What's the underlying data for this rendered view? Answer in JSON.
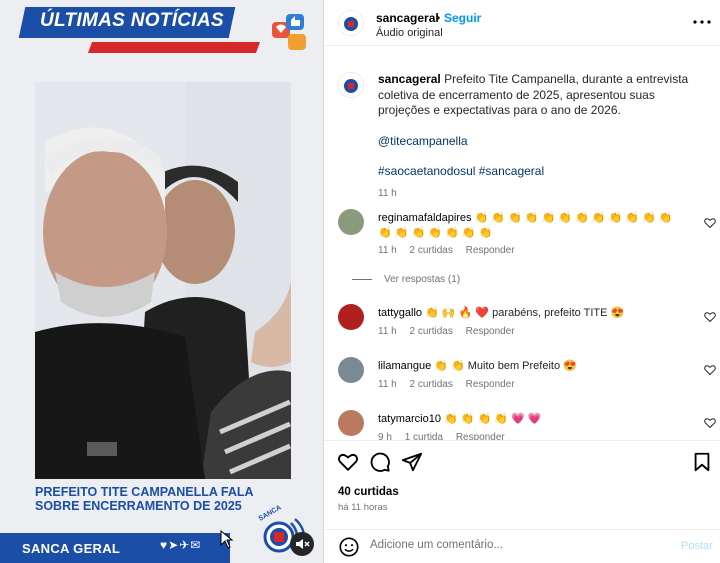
{
  "media": {
    "banner": "ÚLTIMAS NOTÍCIAS",
    "headline_line1": "PREFEITO TITE CAMPANELLA FALA",
    "headline_line2": "SOBRE ENCERRAMENTO DE 2025",
    "brand": "SANCA GERAL",
    "logo_text": "SANCA",
    "colors": {
      "blue": "#1b4ea6",
      "red": "#d62828"
    }
  },
  "header": {
    "username": "sancageral",
    "separator": "•",
    "follow": "Seguir",
    "audio": "Áudio original"
  },
  "caption": {
    "username": "sancageral",
    "text": "Prefeito Tite Campanella, durante a entrevista coletiva de encerramento de 2025, apresentou suas projeções e expectativas para o ano de 2026.",
    "mention": "@titecampanella",
    "hashtags": "#saocaetanodosul #sancageral",
    "time": "11 h"
  },
  "comments": [
    {
      "user": "reginamafaldapires",
      "text": "👏 👏 👏 👏 👏 👏 👏 👏 👏 👏 👏 👏 👏 👏 👏 👏 👏 👏 👏",
      "time": "11 h",
      "likes": "2 curtidas",
      "reply": "Responder",
      "view_replies": "Ver respostas (1)"
    },
    {
      "user": "tattygallo",
      "text": "👏 🙌 🔥 ❤️ parabéns, prefeito TITE 😍",
      "time": "11 h",
      "likes": "2 curtidas",
      "reply": "Responder"
    },
    {
      "user": "lilamangue",
      "text": "👏 👏 Muito bem Prefeito 😍",
      "time": "11 h",
      "likes": "2 curtidas",
      "reply": "Responder"
    },
    {
      "user": "tatymarcio10",
      "text": "👏 👏 👏 👏 💗 💗",
      "time": "9 h",
      "likes": "1 curtida",
      "reply": "Responder"
    }
  ],
  "footer": {
    "likes": "40 curtidas",
    "time_ago": "há 11 horas",
    "comment_placeholder": "Adicione um comentário...",
    "post": "Postar"
  }
}
